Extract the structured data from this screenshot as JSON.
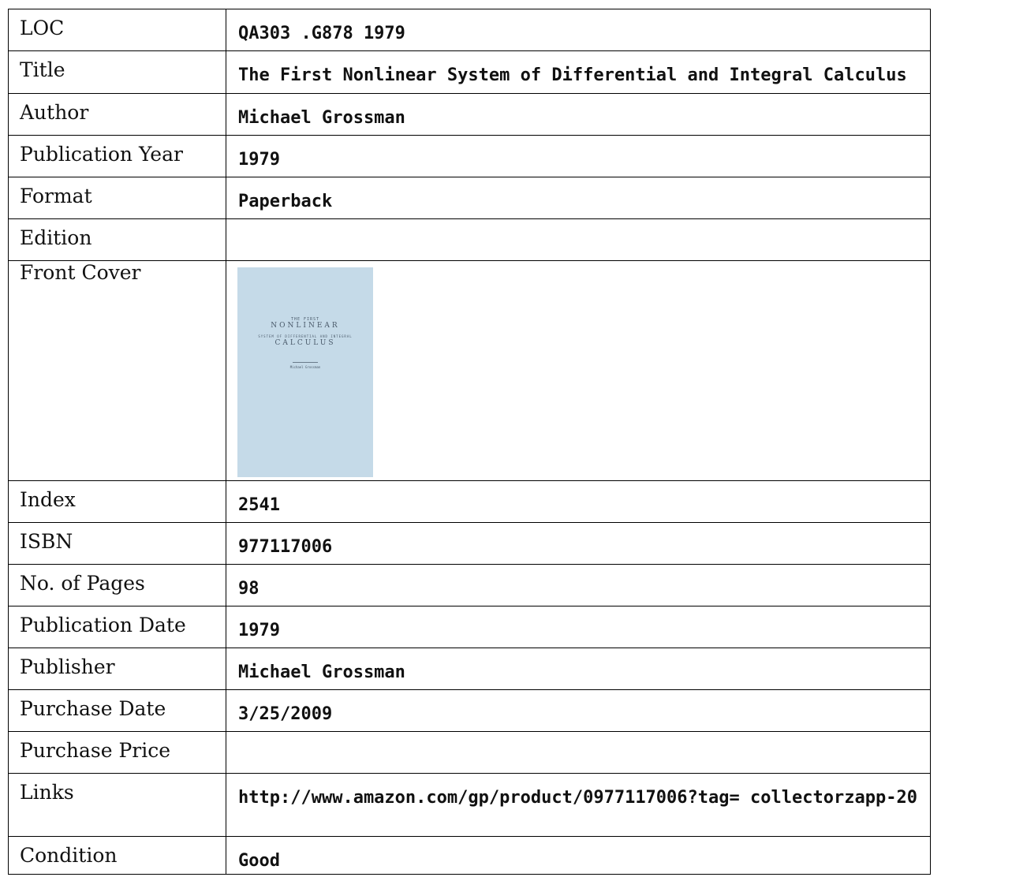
{
  "rows": [
    {
      "label": "LOC",
      "value": "QA303 .G878 1979"
    },
    {
      "label": "Title",
      "value": "The First Nonlinear System of Differential and Integral Calculus"
    },
    {
      "label": "Author",
      "value": "Michael Grossman"
    },
    {
      "label": "Publication Year",
      "value": "1979"
    },
    {
      "label": "Format",
      "value": "Paperback"
    },
    {
      "label": "Edition",
      "value": ""
    },
    {
      "label": "Front Cover",
      "value": ""
    },
    {
      "label": "Index",
      "value": "2541"
    },
    {
      "label": "ISBN",
      "value": "977117006"
    },
    {
      "label": "No. of Pages",
      "value": "98"
    },
    {
      "label": "Publication Date",
      "value": "1979"
    },
    {
      "label": "Publisher",
      "value": "Michael Grossman"
    },
    {
      "label": "Purchase Date",
      "value": "3/25/2009"
    },
    {
      "label": "Purchase Price",
      "value": ""
    },
    {
      "label": "Links",
      "value": "http://www.amazon.com/gp/product/0977117006?tag= collectorzapp-20"
    },
    {
      "label": "Condition",
      "value": "Good"
    }
  ],
  "cover": {
    "line1": "THE FIRST",
    "line2": "NONLINEAR",
    "line3": "SYSTEM OF DIFFERENTIAL AND INTEGRAL",
    "line4": "CALCULUS",
    "line5": "Michael Grossman",
    "color": "#c5dae8"
  }
}
